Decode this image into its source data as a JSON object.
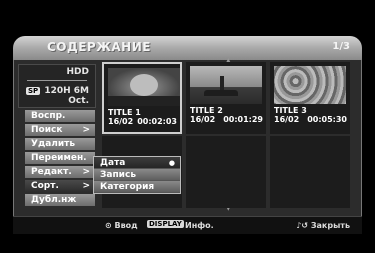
{
  "header": {
    "title": "СОДЕРЖАНИЕ",
    "page": "1/3"
  },
  "source": {
    "name": "HDD",
    "mode_badge": "SP",
    "remaining": "120H 6M",
    "order": "Oct."
  },
  "menu": {
    "items": [
      {
        "label": "Воспр.",
        "arrow": ""
      },
      {
        "label": "Поиск",
        "arrow": ">"
      },
      {
        "label": "Удалить",
        "arrow": ""
      },
      {
        "label": "Переимен.",
        "arrow": ""
      },
      {
        "label": "Редакт.",
        "arrow": ">"
      },
      {
        "label": "Сорт.",
        "arrow": ">"
      },
      {
        "label": "Дубл.нж",
        "arrow": ""
      }
    ]
  },
  "titles": [
    {
      "name": "TITLE 1",
      "date": "16/02",
      "length": "00:02:03",
      "selected": true
    },
    {
      "name": "TITLE 2",
      "date": "16/02",
      "length": "00:01:29",
      "selected": false
    },
    {
      "name": "TITLE 3",
      "date": "16/02",
      "length": "00:05:30",
      "selected": false
    }
  ],
  "sort_popup": {
    "items": [
      {
        "label": "Дата",
        "selected": true,
        "bullet": "●"
      },
      {
        "label": "Запись",
        "selected": false,
        "bullet": ""
      },
      {
        "label": "Категория",
        "selected": false,
        "bullet": ""
      }
    ]
  },
  "footer": {
    "enter_label": "⊙ Ввод",
    "display_badge": "DISPLAY",
    "info_label": "Инфо.",
    "close_label": "♪↺ Закрыть"
  },
  "icons": {
    "scroll_up": "up-arrow-icon",
    "scroll_down": "down-arrow-icon"
  }
}
